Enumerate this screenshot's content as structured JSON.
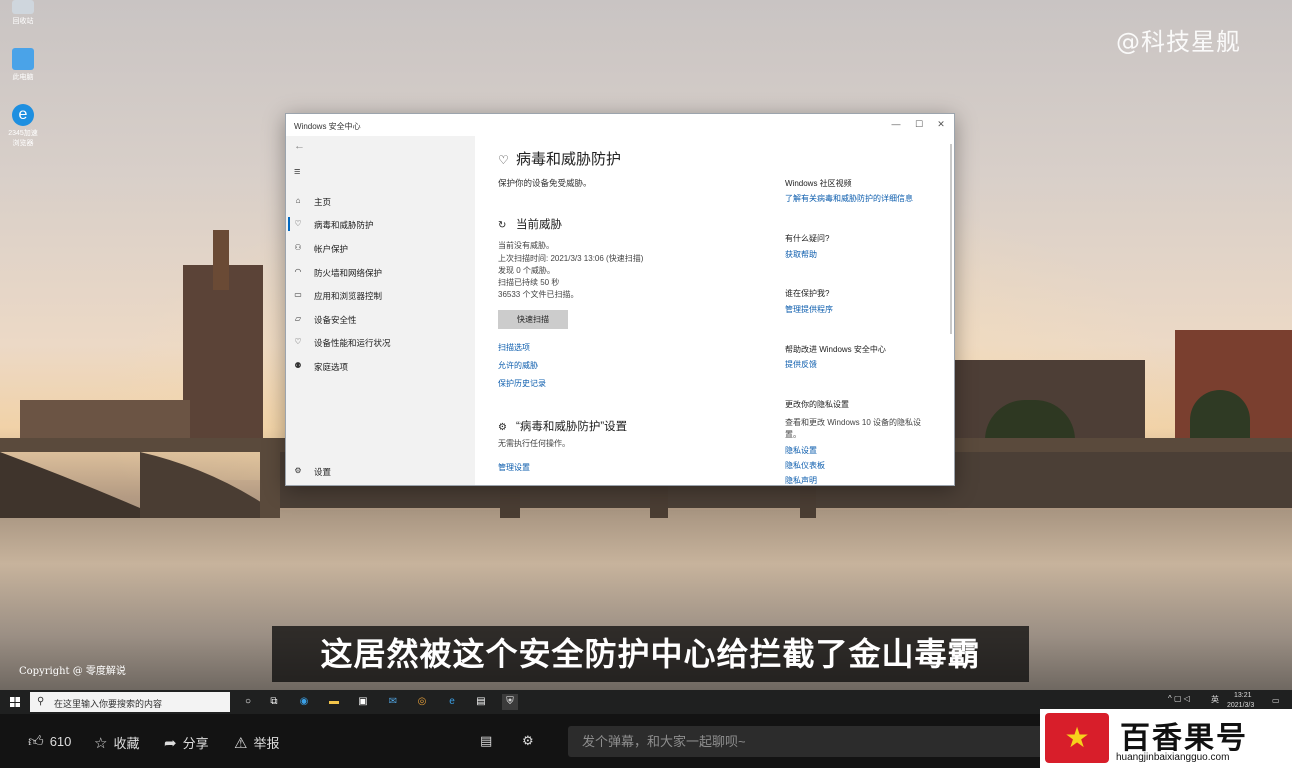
{
  "desktop": {
    "icons": [
      {
        "label": "回收站"
      },
      {
        "label": "此电脑"
      },
      {
        "label": "2345加速浏览器"
      }
    ],
    "watermark": "@科技星舰",
    "copyright": "Copyright @ 零度解说",
    "subtitle": "这居然被这个安全防护中心给拦截了金山毒霸"
  },
  "window": {
    "title": "Windows 安全中心",
    "controls": {
      "minimize": "—",
      "maximize": "☐",
      "close": "✕"
    },
    "nav": {
      "back": "←",
      "menu": "≡",
      "items": [
        {
          "label": "主页",
          "icon": "home-icon",
          "glyph": "⌂"
        },
        {
          "label": "病毒和威胁防护",
          "icon": "shield-icon",
          "glyph": "♡",
          "active": true
        },
        {
          "label": "帐户保护",
          "icon": "person-icon",
          "glyph": "⚇"
        },
        {
          "label": "防火墙和网络保护",
          "icon": "wifi-icon",
          "glyph": "◠"
        },
        {
          "label": "应用和浏览器控制",
          "icon": "window-icon",
          "glyph": "▭"
        },
        {
          "label": "设备安全性",
          "icon": "laptop-icon",
          "glyph": "▱"
        },
        {
          "label": "设备性能和运行状况",
          "icon": "heart-icon",
          "glyph": "♡"
        },
        {
          "label": "家庭选项",
          "icon": "family-icon",
          "glyph": "⚉"
        }
      ],
      "settings": {
        "label": "设置",
        "glyph": "⚙"
      }
    },
    "main": {
      "title": "病毒和威胁防护",
      "subtitle": "保护你的设备免受威胁。",
      "threats": {
        "heading": "当前威胁",
        "lines": [
          "当前没有威胁。",
          "上次扫描时间: 2021/3/3 13:06 (快速扫描)",
          "发现 0 个威胁。",
          "扫描已持续 50 秒",
          "36533 个文件已扫描。"
        ],
        "button": "快速扫描",
        "links": [
          "扫描选项",
          "允许的威胁",
          "保护历史记录"
        ]
      },
      "settings": {
        "heading": "“病毒和威胁防护”设置",
        "text": "无需执行任何操作。",
        "link": "管理设置"
      },
      "right": {
        "sections": [
          {
            "heading": "Windows 社区视频",
            "links": [
              "了解有关病毒和威胁防护的详细信息"
            ]
          },
          {
            "heading": "有什么疑问?",
            "links": [
              "获取帮助"
            ]
          },
          {
            "heading": "谁在保护我?",
            "links": [
              "管理提供程序"
            ]
          },
          {
            "heading": "帮助改进 Windows 安全中心",
            "links": [
              "提供反馈"
            ]
          },
          {
            "heading": "更改你的隐私设置",
            "text": "查看和更改 Windows 10 设备的隐私设置。",
            "links": [
              "隐私设置",
              "隐私仪表板",
              "隐私声明"
            ]
          }
        ]
      }
    }
  },
  "taskbar": {
    "search_placeholder": "在这里输入你要搜索的内容",
    "tray_lang": "英",
    "time": "13:21",
    "date": "2021/3/3"
  },
  "player": {
    "like_count": "610",
    "collect_label": "收藏",
    "share_label": "分享",
    "report_label": "举报",
    "danmu_placeholder": "发个弹幕，和大家一起聊呗~"
  },
  "brand": {
    "name": "百香果号",
    "url": "huangjinbaixiangguo.com"
  }
}
